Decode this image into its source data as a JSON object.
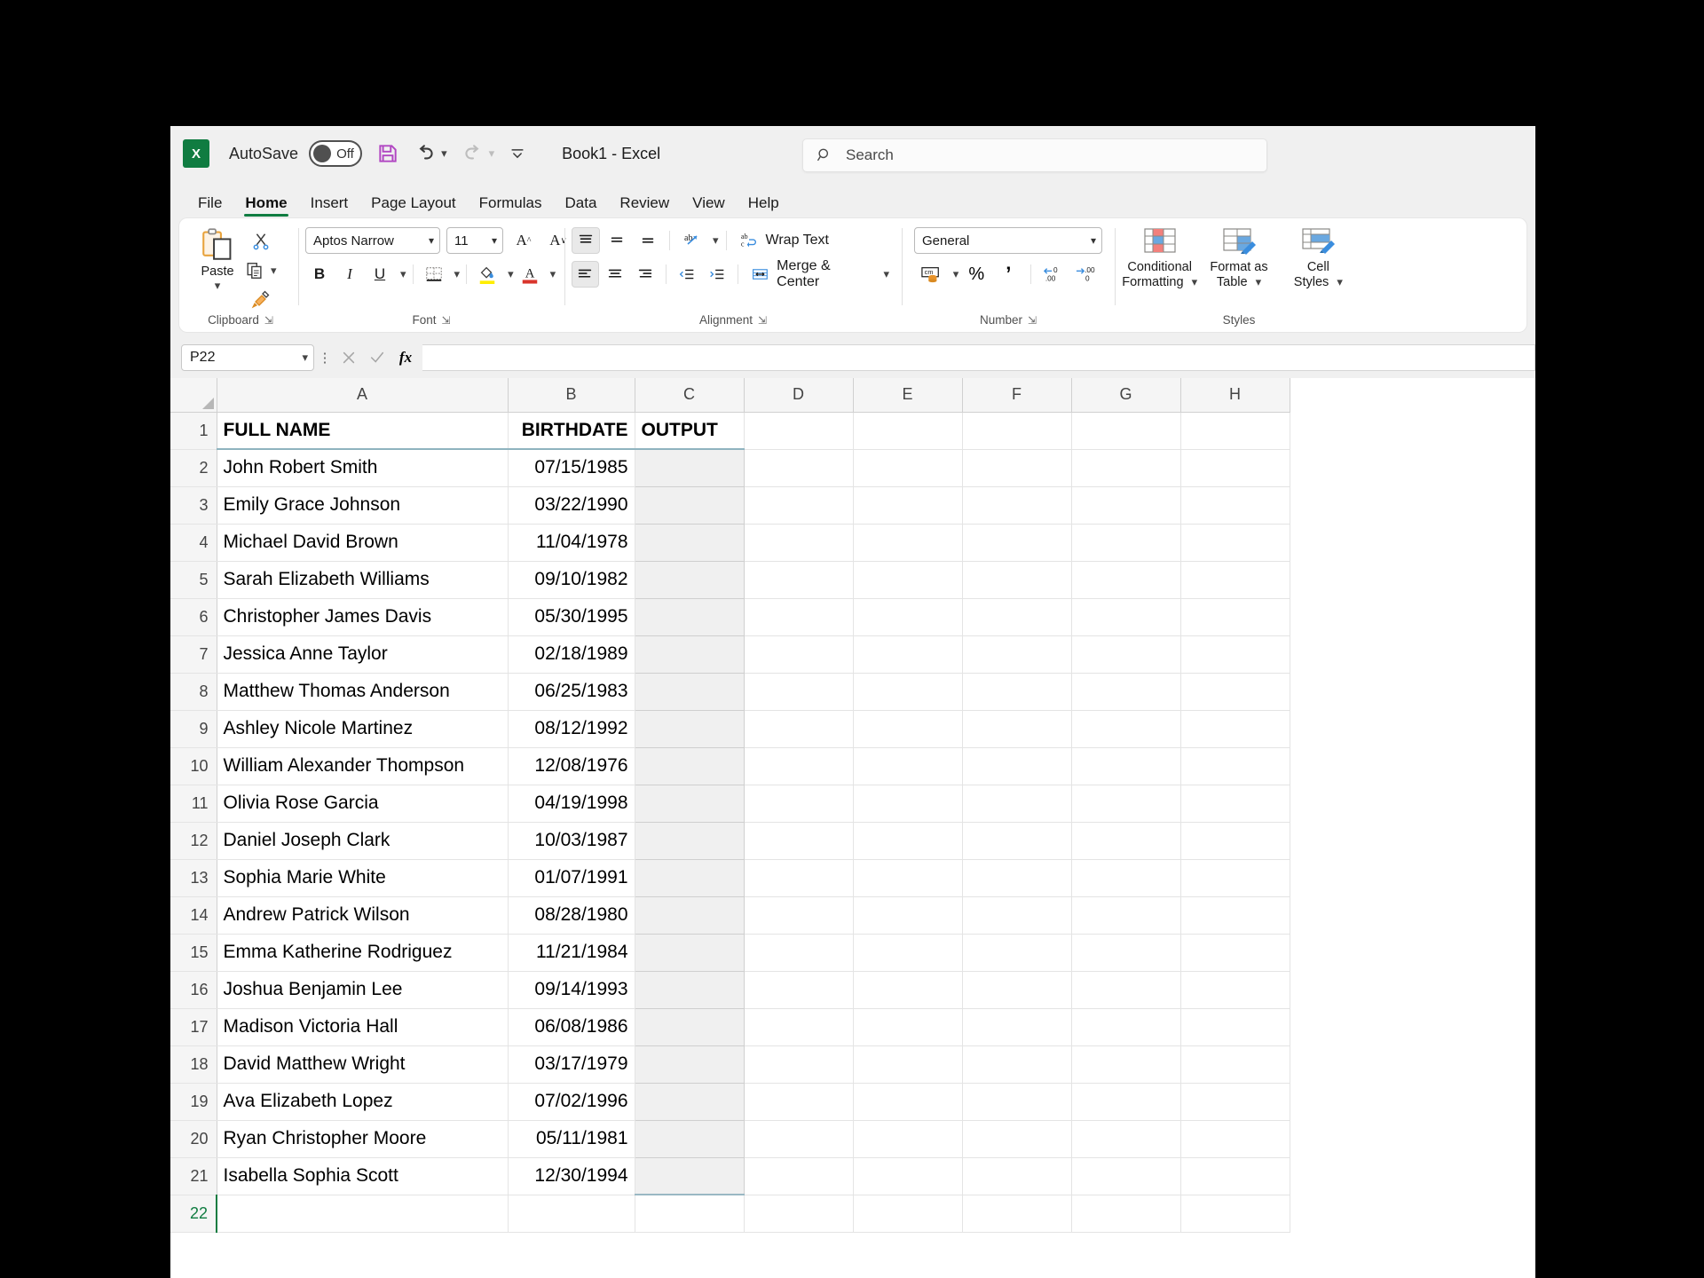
{
  "titlebar": {
    "autosave_label": "AutoSave",
    "autosave_state": "Off",
    "save_icon": "save-icon",
    "undo_icon": "undo-icon",
    "redo_icon": "redo-icon",
    "customize_icon": "customize-quick-access-icon",
    "document_title": "Book1  -  Excel"
  },
  "search": {
    "placeholder": "Search",
    "icon": "search-icon"
  },
  "tabs": [
    {
      "label": "File",
      "active": false
    },
    {
      "label": "Home",
      "active": true
    },
    {
      "label": "Insert",
      "active": false
    },
    {
      "label": "Page Layout",
      "active": false
    },
    {
      "label": "Formulas",
      "active": false
    },
    {
      "label": "Data",
      "active": false
    },
    {
      "label": "Review",
      "active": false
    },
    {
      "label": "View",
      "active": false
    },
    {
      "label": "Help",
      "active": false
    }
  ],
  "ribbon": {
    "clipboard": {
      "group_label": "Clipboard",
      "paste_label": "Paste",
      "cut_icon": "scissors-icon",
      "copy_icon": "copy-icon",
      "format_painter_icon": "format-painter-icon"
    },
    "font": {
      "group_label": "Font",
      "font_name": "Aptos Narrow",
      "font_size": "11",
      "grow_font_label": "A",
      "shrink_font_label": "A",
      "bold_label": "B",
      "italic_label": "I",
      "underline_label": "U",
      "borders_icon": "borders-icon",
      "fill_color_icon": "fill-color-icon",
      "font_color_label": "A"
    },
    "alignment": {
      "group_label": "Alignment",
      "align_top_icon": "align-top-icon",
      "align_middle_icon": "align-middle-icon",
      "align_bottom_icon": "align-bottom-icon",
      "orientation_icon": "orientation-icon",
      "align_left_icon": "align-left-icon",
      "align_center_icon": "align-center-icon",
      "align_right_icon": "align-right-icon",
      "decrease_indent_icon": "decrease-indent-icon",
      "increase_indent_icon": "increase-indent-icon",
      "wrap_text_label": "Wrap Text",
      "merge_center_label": "Merge & Center"
    },
    "number": {
      "group_label": "Number",
      "format_value": "General",
      "accounting_icon": "accounting-format-icon",
      "percent_label": "%",
      "comma_label": "’",
      "increase_decimal_icon": "increase-decimal-icon",
      "decrease_decimal_icon": "decrease-decimal-icon"
    },
    "styles": {
      "group_label": "Styles",
      "conditional_formatting_label": "Conditional\nFormatting",
      "conditional_formatting_line1": "Conditional",
      "conditional_formatting_line2": "Formatting",
      "format_as_table_line1": "Format as",
      "format_as_table_line2": "Table",
      "cell_styles_line1": "Cell",
      "cell_styles_line2": "Styles"
    }
  },
  "formula_bar": {
    "name_box_value": "P22",
    "cancel_icon": "cancel-icon",
    "enter_icon": "enter-icon",
    "function_icon": "fx-icon",
    "formula_value": ""
  },
  "grid": {
    "columns": [
      "A",
      "B",
      "C",
      "D",
      "E",
      "F",
      "G",
      "H"
    ],
    "active_row": "22",
    "headers": {
      "a": "FULL NAME",
      "b": "BIRTHDATE",
      "c": "OUTPUT"
    },
    "rows": [
      {
        "n": "1",
        "name": "FULL NAME",
        "date": "BIRTHDATE",
        "header": true
      },
      {
        "n": "2",
        "name": "John Robert Smith",
        "date": "07/15/1985"
      },
      {
        "n": "3",
        "name": "Emily Grace Johnson",
        "date": "03/22/1990"
      },
      {
        "n": "4",
        "name": "Michael David Brown",
        "date": "11/04/1978"
      },
      {
        "n": "5",
        "name": "Sarah Elizabeth Williams",
        "date": "09/10/1982"
      },
      {
        "n": "6",
        "name": "Christopher James Davis",
        "date": "05/30/1995"
      },
      {
        "n": "7",
        "name": "Jessica Anne Taylor",
        "date": "02/18/1989"
      },
      {
        "n": "8",
        "name": "Matthew Thomas Anderson",
        "date": "06/25/1983"
      },
      {
        "n": "9",
        "name": "Ashley Nicole Martinez",
        "date": "08/12/1992"
      },
      {
        "n": "10",
        "name": "William Alexander Thompson",
        "date": "12/08/1976"
      },
      {
        "n": "11",
        "name": "Olivia Rose Garcia",
        "date": "04/19/1998"
      },
      {
        "n": "12",
        "name": "Daniel Joseph Clark",
        "date": "10/03/1987"
      },
      {
        "n": "13",
        "name": "Sophia Marie White",
        "date": "01/07/1991"
      },
      {
        "n": "14",
        "name": "Andrew Patrick Wilson",
        "date": "08/28/1980"
      },
      {
        "n": "15",
        "name": "Emma Katherine Rodriguez",
        "date": "11/21/1984"
      },
      {
        "n": "16",
        "name": "Joshua Benjamin Lee",
        "date": "09/14/1993"
      },
      {
        "n": "17",
        "name": "Madison Victoria Hall",
        "date": "06/08/1986"
      },
      {
        "n": "18",
        "name": "David Matthew Wright",
        "date": "03/17/1979"
      },
      {
        "n": "19",
        "name": "Ava Elizabeth Lopez",
        "date": "07/02/1996"
      },
      {
        "n": "20",
        "name": "Ryan Christopher Moore",
        "date": "05/11/1981"
      },
      {
        "n": "21",
        "name": "Isabella Sophia Scott",
        "date": "12/30/1994"
      },
      {
        "n": "22",
        "name": "",
        "date": ""
      }
    ]
  },
  "colors": {
    "excel_green": "#107c41",
    "selection_teal": "#5a93a8",
    "selection_fill": "#f0f0f0",
    "ribbon_bg": "#f0f0f0"
  }
}
